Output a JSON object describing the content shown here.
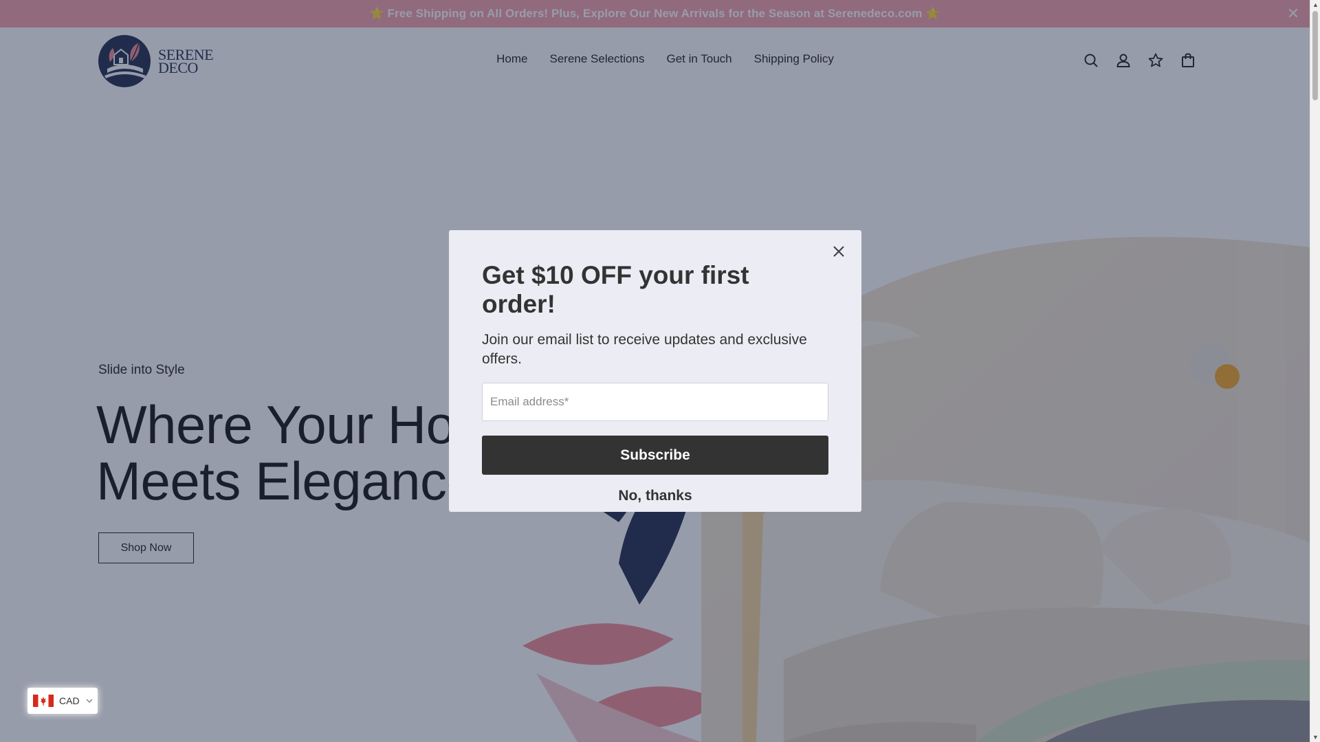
{
  "announcement": {
    "text": "⭐ Free Shipping on All Orders! Plus, Explore Our New Arrivals for the Season at Serenedeco.com ⭐",
    "close_icon": "close-icon"
  },
  "header": {
    "logo_line1": "SERENE",
    "logo_line2": "DECO",
    "nav": [
      {
        "label": "Home"
      },
      {
        "label": "Serene Selections"
      },
      {
        "label": "Get in Touch"
      },
      {
        "label": "Shipping Policy"
      }
    ],
    "icons": [
      "search-icon",
      "account-icon",
      "wishlist-star-icon",
      "shopping-bag-icon"
    ]
  },
  "hero": {
    "subheading": "Slide into Style",
    "title_line1": "Where Your Home",
    "title_line2": "Meets Elegance",
    "cta_label": "Shop Now"
  },
  "currency": {
    "code": "CAD",
    "flag": "canada-flag-icon"
  },
  "modal": {
    "title": "Get $10 OFF your first order!",
    "text": "Join our email list to receive updates and exclusive offers.",
    "email_placeholder": "Email address*",
    "email_value": "",
    "subscribe_label": "Subscribe",
    "decline_label": "No, thanks"
  },
  "colors": {
    "announcement_bg": "#f4a0aa",
    "brand_navy": "#1d2a4d",
    "brand_pink": "#f08a93",
    "modal_bg": "#ececf4",
    "button_dark": "#333333"
  }
}
